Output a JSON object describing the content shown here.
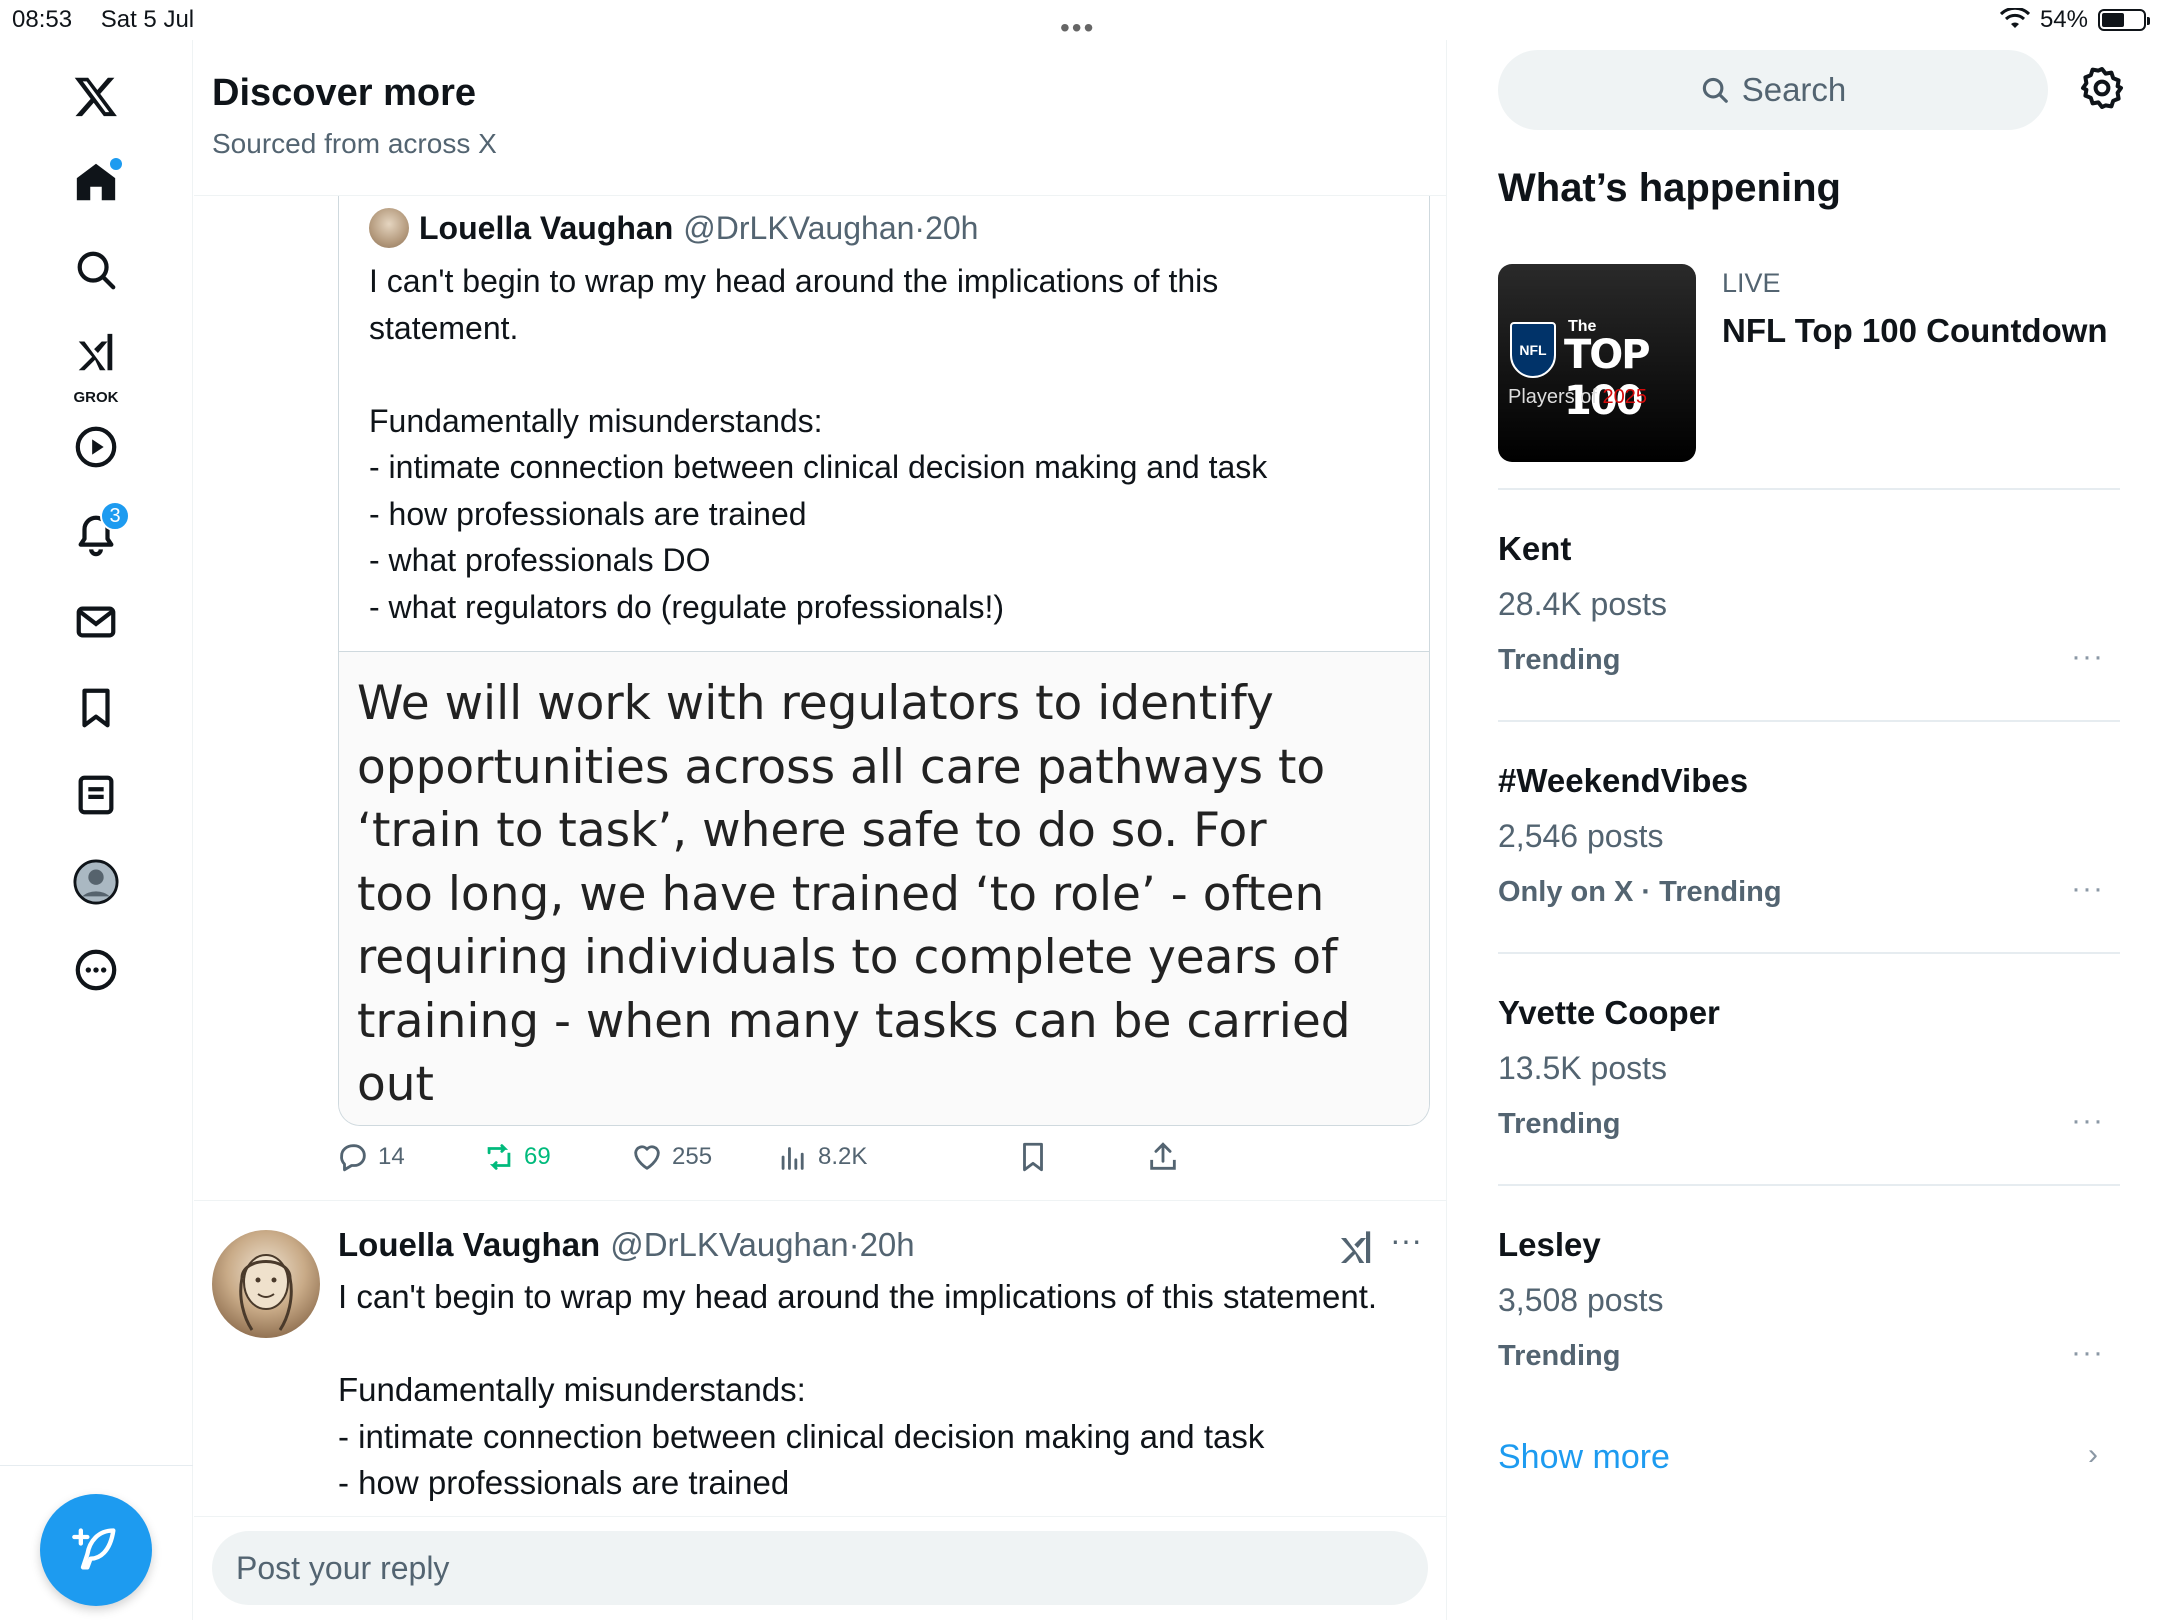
{
  "status_bar": {
    "time": "08:53",
    "date": "Sat 5 Jul",
    "battery_percent_label": "54%",
    "battery_level": 0.54,
    "multitask_dots": "•••"
  },
  "nav": {
    "notifications_count": "3",
    "grok_label": "GROK",
    "items": [
      "x-logo",
      "home",
      "explore",
      "grok",
      "video",
      "notifications",
      "messages",
      "bookmarks",
      "lists",
      "profile",
      "more"
    ],
    "accent_color": "#1d9bf0"
  },
  "discover": {
    "title": "Discover more",
    "subtitle": "Sourced from across X"
  },
  "quoted_post": {
    "author_name": "Louella Vaughan",
    "author_handle": "@DrLKVaughan",
    "time": "·20h",
    "text": "I can't begin to wrap my head around the implications of this\nstatement.\n\nFundamentally misunderstands:\n- intimate connection between clinical decision making and task\n- how professionals are trained\n- what professionals DO\n- what regulators do (regulate professionals!)",
    "image_text": "We will work with regulators to identify\nopportunities across all care pathways to\n‘train to task’, where safe to do so. For\ntoo long, we have trained ‘to role’ - often\nrequiring individuals to complete years of\ntraining - when many tasks can be carried out\nwith good supervision. While we will need"
  },
  "actions": {
    "replies": "14",
    "reposts": "69",
    "likes": "255",
    "views": "8.2K"
  },
  "post": {
    "author_name": "Louella Vaughan",
    "author_handle": "@DrLKVaughan",
    "time": "·20h",
    "more": "···",
    "text": "I can't begin to wrap my head around the implications of this statement.\n\nFundamentally misunderstands:\n- intimate connection between clinical decision making and task\n- how professionals are trained"
  },
  "reply": {
    "placeholder": "Post your reply"
  },
  "sidebar": {
    "search_label": "Search",
    "whats_happening": "What’s happening",
    "live": {
      "label": "LIVE",
      "title": "NFL Top 100 Countdown",
      "thumb_nfl": "NFL",
      "thumb_the": "The",
      "thumb_top": "TOP 100",
      "thumb_players": "Players of ",
      "thumb_year": "2025"
    },
    "trends": [
      {
        "name": "Kent",
        "posts": "28.4K posts",
        "meta": "Trending",
        "more": "···"
      },
      {
        "name": "#WeekendVibes",
        "posts": "2,546 posts",
        "meta": "Only on X · Trending",
        "more": "···"
      },
      {
        "name": "Yvette Cooper",
        "posts": "13.5K posts",
        "meta": "Trending",
        "more": "···"
      },
      {
        "name": "Lesley",
        "posts": "3,508 posts",
        "meta": "Trending",
        "more": "···"
      }
    ],
    "show_more": "Show more",
    "show_more_chevron": "›"
  }
}
